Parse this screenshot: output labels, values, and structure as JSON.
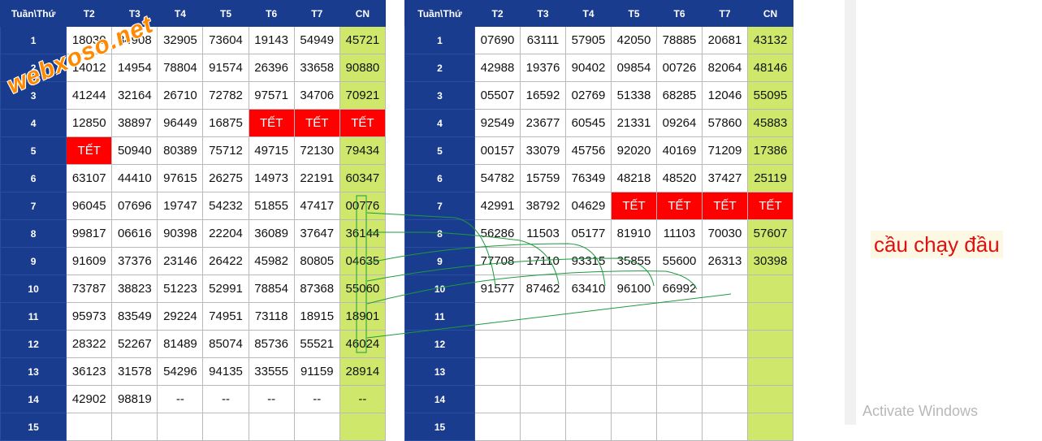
{
  "left": {
    "header": [
      "Tuần\\Thứ",
      "T2",
      "T3",
      "T4",
      "T5",
      "T6",
      "T7",
      "CN"
    ],
    "rows": [
      [
        "1",
        "18030",
        "84908",
        "32905",
        "73604",
        "19143",
        "54949",
        "45721"
      ],
      [
        "2",
        "14012",
        "14954",
        "78804",
        "91574",
        "26396",
        "33658",
        "90880"
      ],
      [
        "3",
        "41244",
        "32164",
        "26710",
        "72782",
        "97571",
        "34706",
        "70921"
      ],
      [
        "4",
        "12850",
        "38897",
        "96449",
        "16875",
        "TẾT",
        "TẾT",
        "TẾT"
      ],
      [
        "5",
        "TẾT",
        "50940",
        "80389",
        "75712",
        "49715",
        "72130",
        "79434"
      ],
      [
        "6",
        "63107",
        "44410",
        "97615",
        "26275",
        "14973",
        "22191",
        "60347"
      ],
      [
        "7",
        "96045",
        "07696",
        "19747",
        "54232",
        "51855",
        "47417",
        "00776"
      ],
      [
        "8",
        "99817",
        "06616",
        "90398",
        "22204",
        "36089",
        "37647",
        "36144"
      ],
      [
        "9",
        "91609",
        "37376",
        "23146",
        "26422",
        "45982",
        "80805",
        "04635"
      ],
      [
        "10",
        "73787",
        "38823",
        "51223",
        "52991",
        "78854",
        "87368",
        "55060"
      ],
      [
        "11",
        "95973",
        "83549",
        "29224",
        "74951",
        "73118",
        "18915",
        "18901"
      ],
      [
        "12",
        "28322",
        "52267",
        "81489",
        "85074",
        "85736",
        "55521",
        "46024"
      ],
      [
        "13",
        "36123",
        "31578",
        "54296",
        "94135",
        "33555",
        "91159",
        "28914"
      ],
      [
        "14",
        "42902",
        "98819",
        "--",
        "--",
        "--",
        "--",
        "--"
      ],
      [
        "15",
        "",
        "",
        "",
        "",
        "",
        "",
        ""
      ]
    ]
  },
  "right": {
    "header": [
      "Tuần\\Thứ",
      "T2",
      "T3",
      "T4",
      "T5",
      "T6",
      "T7",
      "CN"
    ],
    "rows": [
      [
        "1",
        "07690",
        "63111",
        "57905",
        "42050",
        "78885",
        "20681",
        "43132"
      ],
      [
        "2",
        "42988",
        "19376",
        "90402",
        "09854",
        "00726",
        "82064",
        "48146"
      ],
      [
        "3",
        "05507",
        "16592",
        "02769",
        "51338",
        "68285",
        "12046",
        "55095"
      ],
      [
        "4",
        "92549",
        "23677",
        "60545",
        "21331",
        "09264",
        "57860",
        "45883"
      ],
      [
        "5",
        "00157",
        "33079",
        "45756",
        "92020",
        "40169",
        "71209",
        "17386"
      ],
      [
        "6",
        "54782",
        "15759",
        "76349",
        "48218",
        "48520",
        "37427",
        "25119"
      ],
      [
        "7",
        "42991",
        "38792",
        "04629",
        "TẾT",
        "TẾT",
        "TẾT",
        "TẾT"
      ],
      [
        "8",
        "56286",
        "11503",
        "05177",
        "81910",
        "11103",
        "70030",
        "57607"
      ],
      [
        "9",
        "77708",
        "17110",
        "93315",
        "35855",
        "55600",
        "26313",
        "30398"
      ],
      [
        "10",
        "91577",
        "87462",
        "63410",
        "96100",
        "66992",
        "",
        ""
      ],
      [
        "11",
        "",
        "",
        "",
        "",
        "",
        "",
        ""
      ],
      [
        "12",
        "",
        "",
        "",
        "",
        "",
        "",
        ""
      ],
      [
        "13",
        "",
        "",
        "",
        "",
        "",
        "",
        ""
      ],
      [
        "14",
        "",
        "",
        "",
        "",
        "",
        "",
        ""
      ],
      [
        "15",
        "",
        "",
        "",
        "",
        "",
        "",
        ""
      ]
    ]
  },
  "watermark": "webxoso.net",
  "annotation": "cầu chạy đầu",
  "os_notice": "Activate Windows",
  "colors": {
    "header_bg": "#1a3c8f",
    "cn_bg": "#cfe86c",
    "tet_bg": "#ff0000",
    "line": "#1d9a3c",
    "label": "#e01010"
  }
}
